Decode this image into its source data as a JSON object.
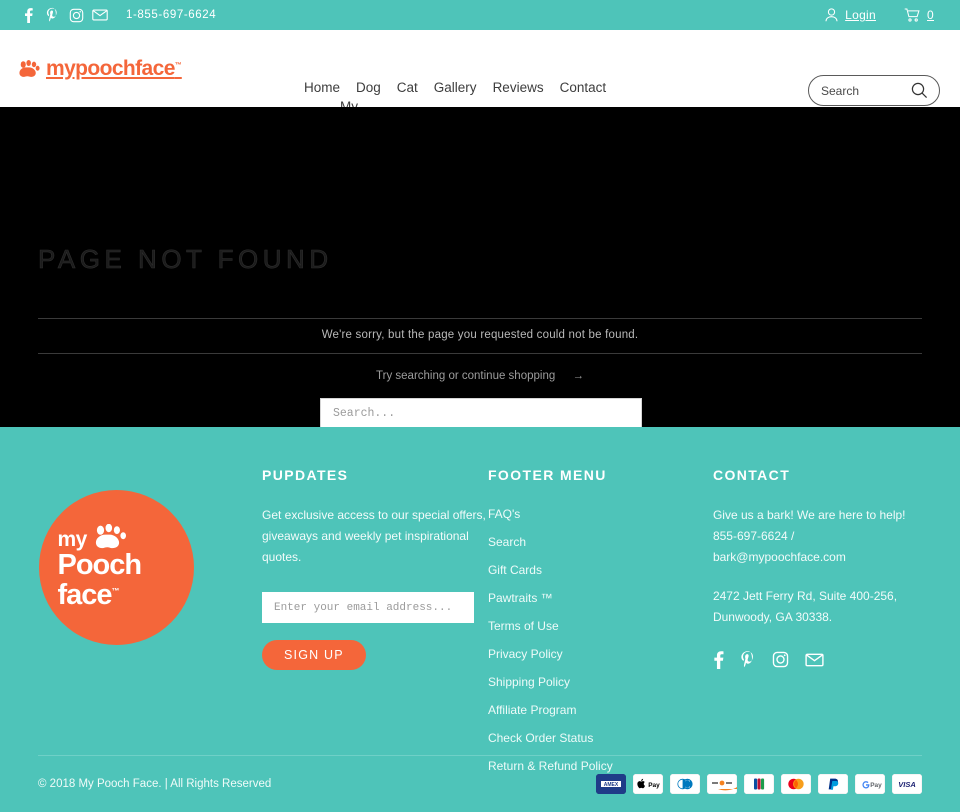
{
  "theme": {
    "teal": "#4ec4b9",
    "orange": "#f4663a",
    "black": "#000000",
    "white": "#ffffff"
  },
  "topbar": {
    "social": [
      {
        "name": "facebook-icon",
        "label": "Facebook"
      },
      {
        "name": "pinterest-icon",
        "label": "Pinterest"
      },
      {
        "name": "instagram-icon",
        "label": "Instagram"
      },
      {
        "name": "email-icon",
        "label": "Email"
      }
    ],
    "phone": "1-855-697-6624",
    "login_label": "Login",
    "cart_count": "0"
  },
  "header": {
    "logo_text": "mypoochface",
    "logo_tm": "™",
    "nav": [
      {
        "label": "Home"
      },
      {
        "label": "Dog"
      },
      {
        "label": "Cat"
      },
      {
        "label": "Gallery"
      },
      {
        "label": "Reviews"
      },
      {
        "label": "Contact"
      },
      {
        "label": "My Wishlist"
      }
    ],
    "search_placeholder": "Search"
  },
  "hero": {
    "title": "PAGE NOT FOUND",
    "message": "We're sorry, but the page you requested could not be found.",
    "sub_text": "Try searching or continue shopping",
    "sub_arrow": "→",
    "search_placeholder": "Search..."
  },
  "footer": {
    "badge": {
      "my": "my",
      "pooch": "Pooch",
      "face": "face",
      "tm": "™"
    },
    "pupdates": {
      "heading": "PUPDATES",
      "body": "Get exclusive access to our special offers, giveaways and weekly pet inspirational quotes.",
      "email_placeholder": "Enter your email address...",
      "signup_label": "SIGN UP"
    },
    "menu": {
      "heading": "FOOTER MENU",
      "items": [
        {
          "label": "FAQ's"
        },
        {
          "label": "Search"
        },
        {
          "label": "Gift Cards"
        },
        {
          "label": "Pawtraits ™"
        },
        {
          "label": "Terms of Use"
        },
        {
          "label": "Privacy Policy"
        },
        {
          "label": "Shipping Policy"
        },
        {
          "label": "Affiliate Program"
        },
        {
          "label": "Check Order Status"
        },
        {
          "label": "Return & Refund Policy"
        }
      ]
    },
    "contact": {
      "heading": "CONTACT",
      "line1": "Give us a bark! We are here to help! 855-697-6624 / bark@mypoochface.com",
      "line2": "2472 Jett Ferry Rd, Suite 400-256, Dunwoody, GA  30338.",
      "social": [
        {
          "name": "facebook-icon",
          "label": "Facebook"
        },
        {
          "name": "pinterest-icon",
          "label": "Pinterest"
        },
        {
          "name": "instagram-icon",
          "label": "Instagram"
        },
        {
          "name": "email-icon",
          "label": "Email"
        }
      ]
    },
    "copyright": "© 2018 My Pooch Face. | All Rights Reserved",
    "payments": [
      {
        "name": "amex",
        "label": "AMEX"
      },
      {
        "name": "apple-pay",
        "label": "Pay"
      },
      {
        "name": "diners-club",
        "label": "Diners"
      },
      {
        "name": "discover",
        "label": "Discover"
      },
      {
        "name": "jcb",
        "label": "JCB"
      },
      {
        "name": "mastercard",
        "label": "Mastercard"
      },
      {
        "name": "paypal",
        "label": "PayPal"
      },
      {
        "name": "google-pay",
        "label": "Pay"
      },
      {
        "name": "visa",
        "label": "VISA"
      }
    ]
  }
}
